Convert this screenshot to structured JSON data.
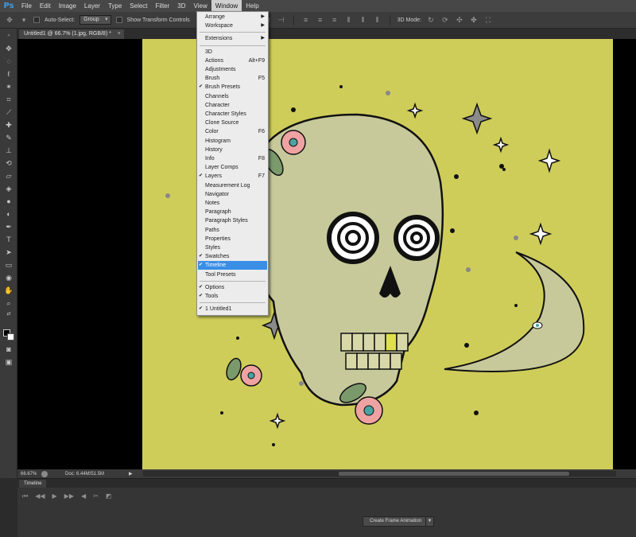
{
  "app": {
    "logo": "Ps"
  },
  "menubar": {
    "items": [
      "File",
      "Edit",
      "Image",
      "Layer",
      "Type",
      "Select",
      "Filter",
      "3D",
      "View",
      "Window",
      "Help"
    ]
  },
  "options_bar": {
    "auto_select_label": "Auto-Select:",
    "auto_select_value": "Group",
    "show_transform_label": "Show Transform Controls",
    "mode_3d_label": "3D Mode:"
  },
  "document": {
    "tab_title": "Untitled1 @ 66.7% (1.jpg, RGB/8) *",
    "close_glyph": "×"
  },
  "status": {
    "zoom": "66.67%",
    "doc_size": "Doc: 6.44M/51.5M",
    "arrow": "▶",
    "scroll_left": "◀",
    "scroll_right": "▶"
  },
  "timeline": {
    "tab_label": "Timeline",
    "create_button": "Create Frame Animation",
    "dropdown_glyph": "▼"
  },
  "window_menu": {
    "items": [
      {
        "label": "Arrange",
        "submenu": true
      },
      {
        "label": "Workspace",
        "submenu": true
      },
      {
        "separator": true
      },
      {
        "label": "Extensions",
        "submenu": true
      },
      {
        "separator": true
      },
      {
        "label": "3D"
      },
      {
        "label": "Actions",
        "shortcut": "Alt+F9"
      },
      {
        "label": "Adjustments"
      },
      {
        "label": "Brush",
        "shortcut": "F5"
      },
      {
        "label": "Brush Presets",
        "checked": true
      },
      {
        "label": "Channels"
      },
      {
        "label": "Character"
      },
      {
        "label": "Character Styles"
      },
      {
        "label": "Clone Source"
      },
      {
        "label": "Color",
        "shortcut": "F6"
      },
      {
        "label": "Histogram"
      },
      {
        "label": "History"
      },
      {
        "label": "Info",
        "shortcut": "F8"
      },
      {
        "label": "Layer Comps"
      },
      {
        "label": "Layers",
        "shortcut": "F7",
        "checked": true
      },
      {
        "label": "Measurement Log"
      },
      {
        "label": "Navigator"
      },
      {
        "label": "Notes"
      },
      {
        "label": "Paragraph"
      },
      {
        "label": "Paragraph Styles"
      },
      {
        "label": "Paths"
      },
      {
        "label": "Properties"
      },
      {
        "label": "Styles"
      },
      {
        "label": "Swatches",
        "checked": true
      },
      {
        "label": "Timeline",
        "checked": true,
        "highlighted": true
      },
      {
        "label": "Tool Presets"
      },
      {
        "separator": true
      },
      {
        "label": "Options",
        "checked": true
      },
      {
        "label": "Tools",
        "checked": true
      },
      {
        "separator": true
      },
      {
        "label": "1 Untitled1",
        "checked": true
      }
    ]
  },
  "colors": {
    "canvas_bg": "#cfcd5a",
    "highlight": "#3a8ee6",
    "skull": "#c7c99a",
    "flower": "#efa2a2",
    "leaf": "#7b9a6b",
    "star": "#8a8a8a"
  }
}
